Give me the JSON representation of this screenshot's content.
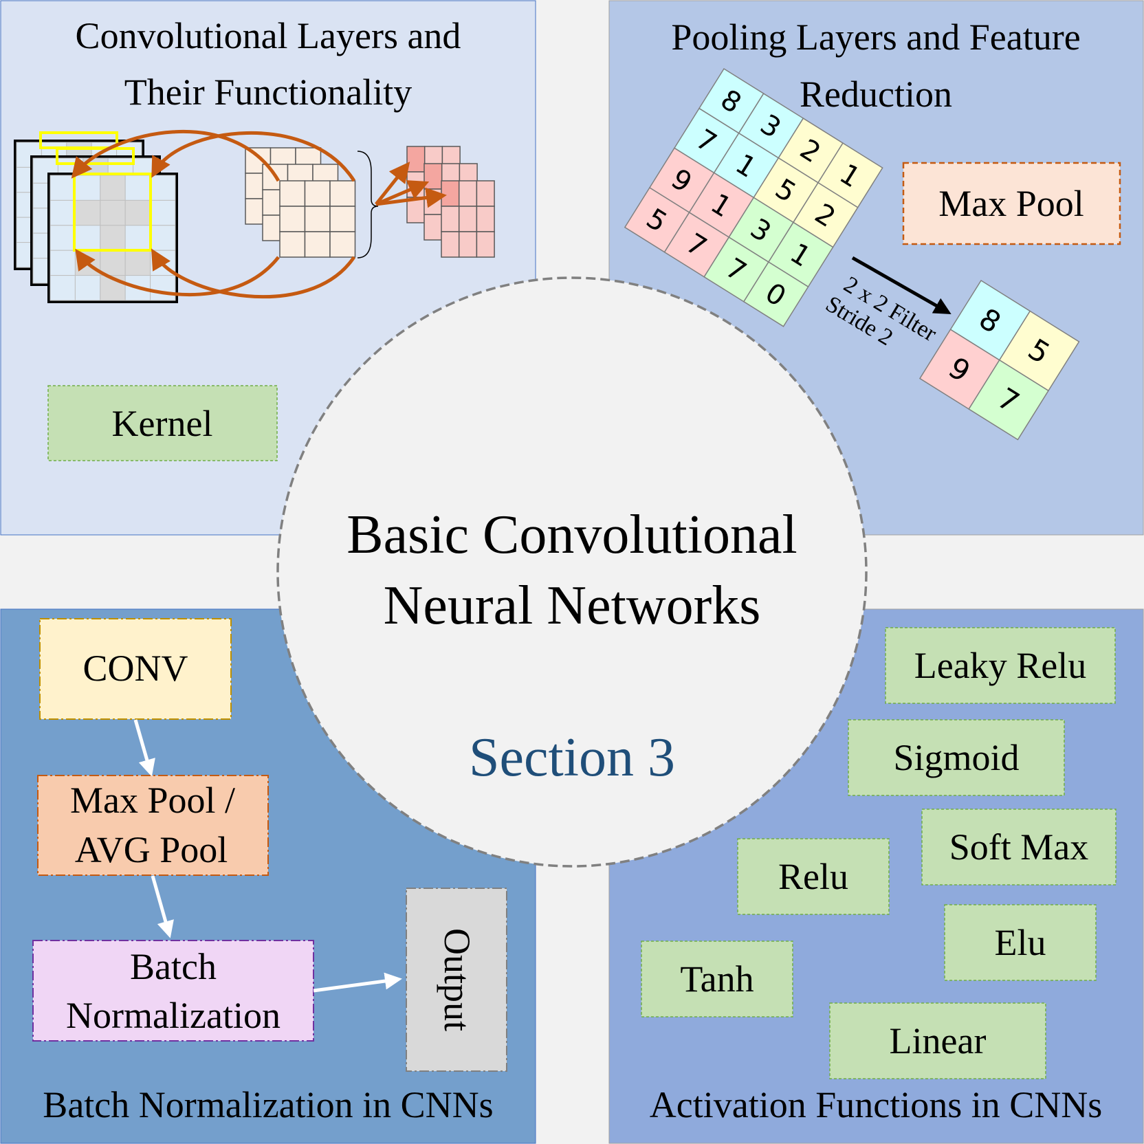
{
  "center": {
    "title_line1": "Basic Convolutional",
    "title_line2": "Neural Networks",
    "section": "Section 3",
    "section_color": "#1f4e79"
  },
  "top_left": {
    "title_line1": "Convolutional Layers and",
    "title_line2": "Their Functionality",
    "kernel_label": "Kernel",
    "color": "#dae3f3"
  },
  "top_right": {
    "title_line1": "Pooling Layers and Feature",
    "title_line2": "Reduction",
    "maxpool_label": "Max Pool",
    "filter_label": "2 x 2 Filter",
    "stride_label": "Stride 2",
    "color": "#b4c7e7",
    "input_grid": [
      [
        "8",
        "3",
        "2",
        "1"
      ],
      [
        "7",
        "1",
        "5",
        "2"
      ],
      [
        "9",
        "1",
        "3",
        "1"
      ],
      [
        "5",
        "7",
        "7",
        "0"
      ]
    ],
    "output_grid": [
      [
        "8",
        "5"
      ],
      [
        "9",
        "7"
      ]
    ]
  },
  "bottom_left": {
    "title": "Batch Normalization in CNNs",
    "conv_label": "CONV",
    "pool_line1": "Max Pool /",
    "pool_line2": "AVG Pool",
    "bn_line1": "Batch",
    "bn_line2": "Normalization",
    "output_label": "Output",
    "color": "#749fcc"
  },
  "bottom_right": {
    "title": "Activation Functions in CNNs",
    "color": "#8faadc",
    "functions": [
      "Leaky Relu",
      "Sigmoid",
      "Soft Max",
      "Relu",
      "Elu",
      "Tanh",
      "Linear"
    ]
  }
}
